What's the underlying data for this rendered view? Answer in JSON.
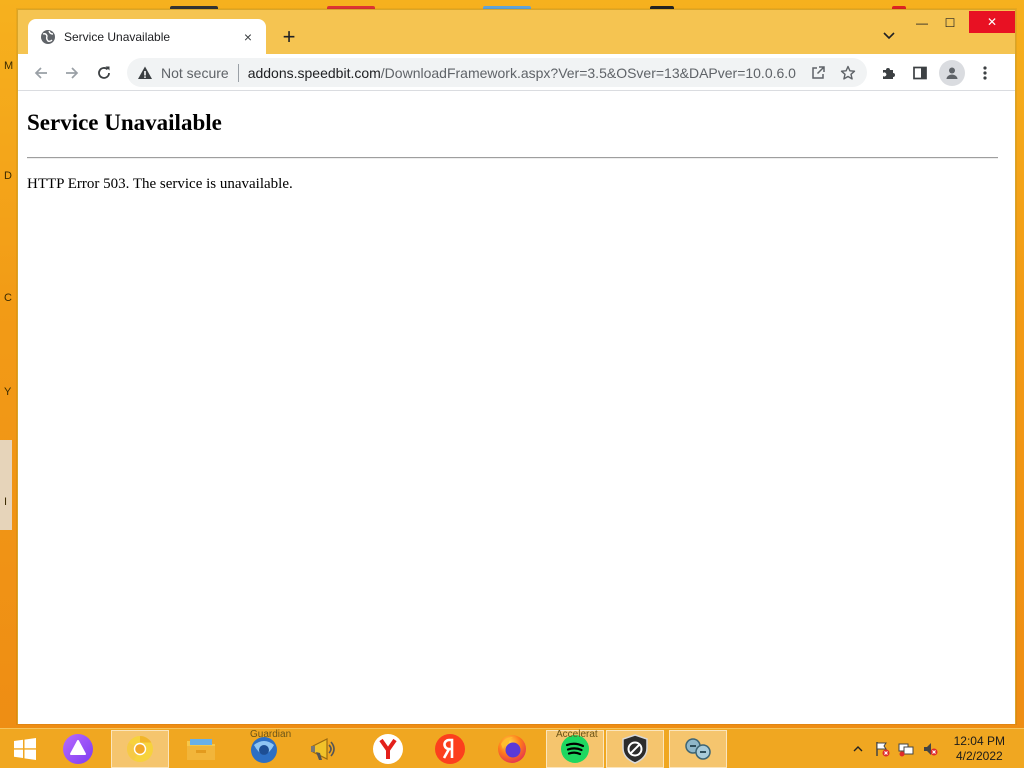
{
  "browser": {
    "tab": {
      "title": "Service Unavailable",
      "close_glyph": "×"
    },
    "new_tab_glyph": "+",
    "window_controls": {
      "minimize": "—",
      "maximize": "☐",
      "close": "✕"
    },
    "security": {
      "label": "Not secure"
    },
    "url": {
      "host": "addons.speedbit.com",
      "path": "/DownloadFramework.aspx?Ver=3.5&OSver=13&DAPver=10.0.6.0"
    }
  },
  "page": {
    "heading": "Service Unavailable",
    "message": "HTTP Error 503. The service is unavailable."
  },
  "desktop": {
    "edge_letters": [
      "M",
      "D",
      "C",
      "Y",
      "I"
    ]
  },
  "taskbar": {
    "captions": {
      "guardian": "Guardian",
      "accelerate": "Accelerat"
    },
    "clock": {
      "time": "12:04 PM",
      "date": "4/2/2022"
    }
  },
  "colors": {
    "desktop": "#f29b16",
    "titlebar": "#f5c451",
    "close_button": "#e81123",
    "taskbar": "#f0a721"
  }
}
